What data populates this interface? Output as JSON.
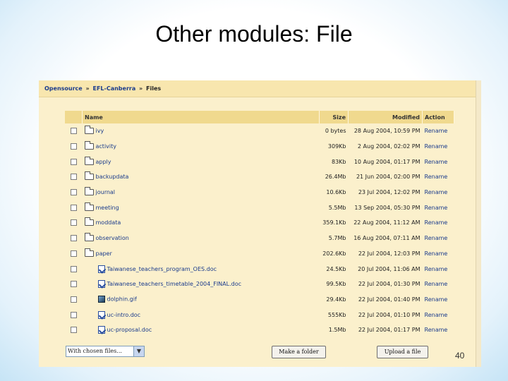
{
  "slide": {
    "title": "Other modules: File",
    "page_number": "40"
  },
  "breadcrumb": {
    "items": [
      "Opensource",
      "EFL-Canberra",
      "Files"
    ],
    "separator": "»"
  },
  "table": {
    "headers": {
      "name": "Name",
      "size": "Size",
      "modified": "Modified",
      "action": "Action"
    },
    "rows": [
      {
        "type": "folder",
        "name": "ivy",
        "size": "0 bytes",
        "modified": "28 Aug 2004, 10:59 PM",
        "action": "Rename"
      },
      {
        "type": "folder",
        "name": "activity",
        "size": "309Kb",
        "modified": "2 Aug 2004, 02:02 PM",
        "action": "Rename"
      },
      {
        "type": "folder",
        "name": "apply",
        "size": "83Kb",
        "modified": "10 Aug 2004, 01:17 PM",
        "action": "Rename"
      },
      {
        "type": "folder",
        "name": "backupdata",
        "size": "26.4Mb",
        "modified": "21 Jun 2004, 02:00 PM",
        "action": "Rename"
      },
      {
        "type": "folder",
        "name": "journal",
        "size": "10.6Kb",
        "modified": "23 Jul 2004, 12:02 PM",
        "action": "Rename"
      },
      {
        "type": "folder",
        "name": "meeting",
        "size": "5.5Mb",
        "modified": "13 Sep 2004, 05:30 PM",
        "action": "Rename"
      },
      {
        "type": "folder",
        "name": "moddata",
        "size": "359.1Kb",
        "modified": "22 Aug 2004, 11:12 AM",
        "action": "Rename"
      },
      {
        "type": "folder",
        "name": "observation",
        "size": "5.7Mb",
        "modified": "16 Aug 2004, 07:11 AM",
        "action": "Rename"
      },
      {
        "type": "folder",
        "name": "paper",
        "size": "202.6Kb",
        "modified": "22 Jul 2004, 12:03 PM",
        "action": "Rename"
      },
      {
        "type": "doc",
        "name": "Taiwanese_teachers_program_OES.doc",
        "size": "24.5Kb",
        "modified": "20 Jul 2004, 11:06 AM",
        "action": "Rename"
      },
      {
        "type": "doc",
        "name": "Taiwanese_teachers_timetable_2004_FINAL.doc",
        "size": "99.5Kb",
        "modified": "22 Jul 2004, 01:30 PM",
        "action": "Rename"
      },
      {
        "type": "image",
        "name": "dolphin.gif",
        "size": "29.4Kb",
        "modified": "22 Jul 2004, 01:40 PM",
        "action": "Rename"
      },
      {
        "type": "doc",
        "name": "uc-intro.doc",
        "size": "555Kb",
        "modified": "22 Jul 2004, 01:10 PM",
        "action": "Rename"
      },
      {
        "type": "doc",
        "name": "uc-proposal.doc",
        "size": "1.5Mb",
        "modified": "22 Jul 2004, 01:17 PM",
        "action": "Rename"
      }
    ]
  },
  "controls": {
    "with_chosen_files": "With chosen files...",
    "make_folder": "Make a folder",
    "upload_file": "Upload a file"
  }
}
